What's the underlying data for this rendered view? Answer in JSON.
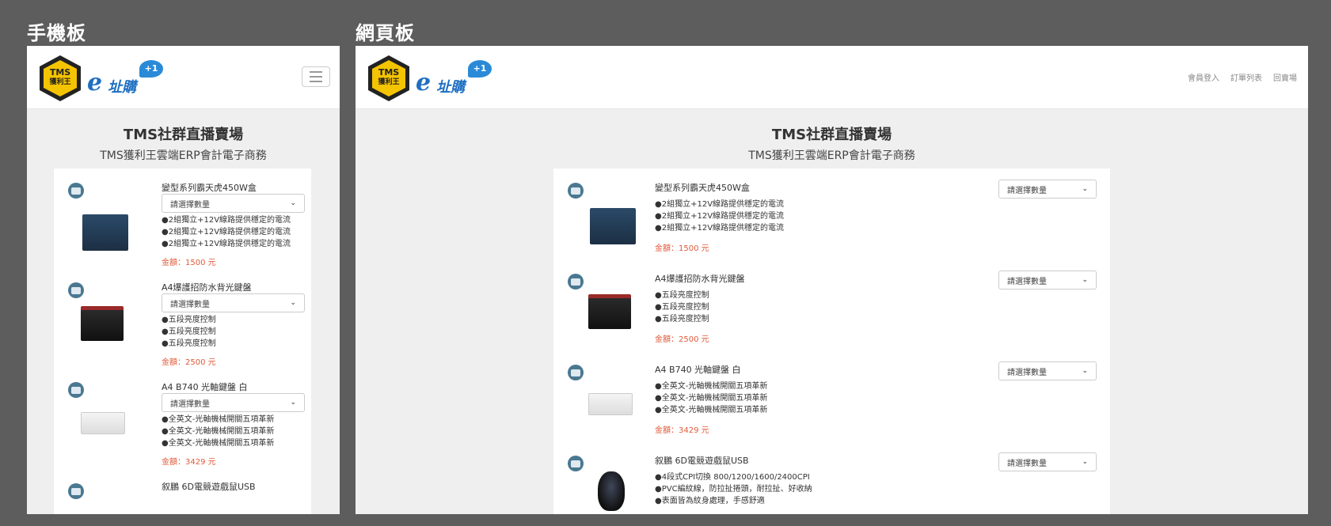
{
  "labels": {
    "mobile": "手機板",
    "desktop": "網頁板"
  },
  "logo": {
    "hex_line1": "TMS",
    "hex_line2": "獲利王",
    "brand_e": "e",
    "brand_text": "址購",
    "bubble": "+1"
  },
  "nav": {
    "items": [
      "會員登入",
      "訂單列表",
      "回賣場"
    ]
  },
  "hero": {
    "title": "TMS社群直播賣場",
    "subtitle": "TMS獲利王雲端ERP會計電子商務"
  },
  "select_placeholder": "請選擇數量",
  "products": [
    {
      "name": "變型系列霸天虎450W盒",
      "features": [
        "●2組獨立+12V線路提供穩定的電流",
        "●2組獨立+12V線路提供穩定的電流",
        "●2組獨立+12V線路提供穩定的電流"
      ],
      "price": "金額：1500 元",
      "image": "power-supply-box"
    },
    {
      "name": "A4爆護招防水背光鍵盤",
      "features": [
        "●五段亮度控制",
        "●五段亮度控制",
        "●五段亮度控制"
      ],
      "price": "金額：2500 元",
      "image": "keyboard-black"
    },
    {
      "name": "A4 B740 光軸鍵盤 白",
      "features": [
        "●全英文-光軸機械開關五項革新",
        "●全英文-光軸機械開關五項革新",
        "●全英文-光軸機械開關五項革新"
      ],
      "price": "金額：3429 元",
      "image": "keyboard-white"
    },
    {
      "name": "叙鵬 6D電競遊戲鼠USB",
      "features": [
        "●4段式CPI切換 800/1200/1600/2400CPI",
        "●PVC編紋線，防拉扯捲頭，耐拉扯、好收納",
        "●表面皆為紋身處理，手感舒適"
      ],
      "price": "",
      "image": "gaming-mouse"
    }
  ],
  "colors": {
    "background": "#5d5d5d",
    "price": "#e05a3a",
    "brand_blue": "#1f6fc2",
    "pin": "#4a7891"
  }
}
